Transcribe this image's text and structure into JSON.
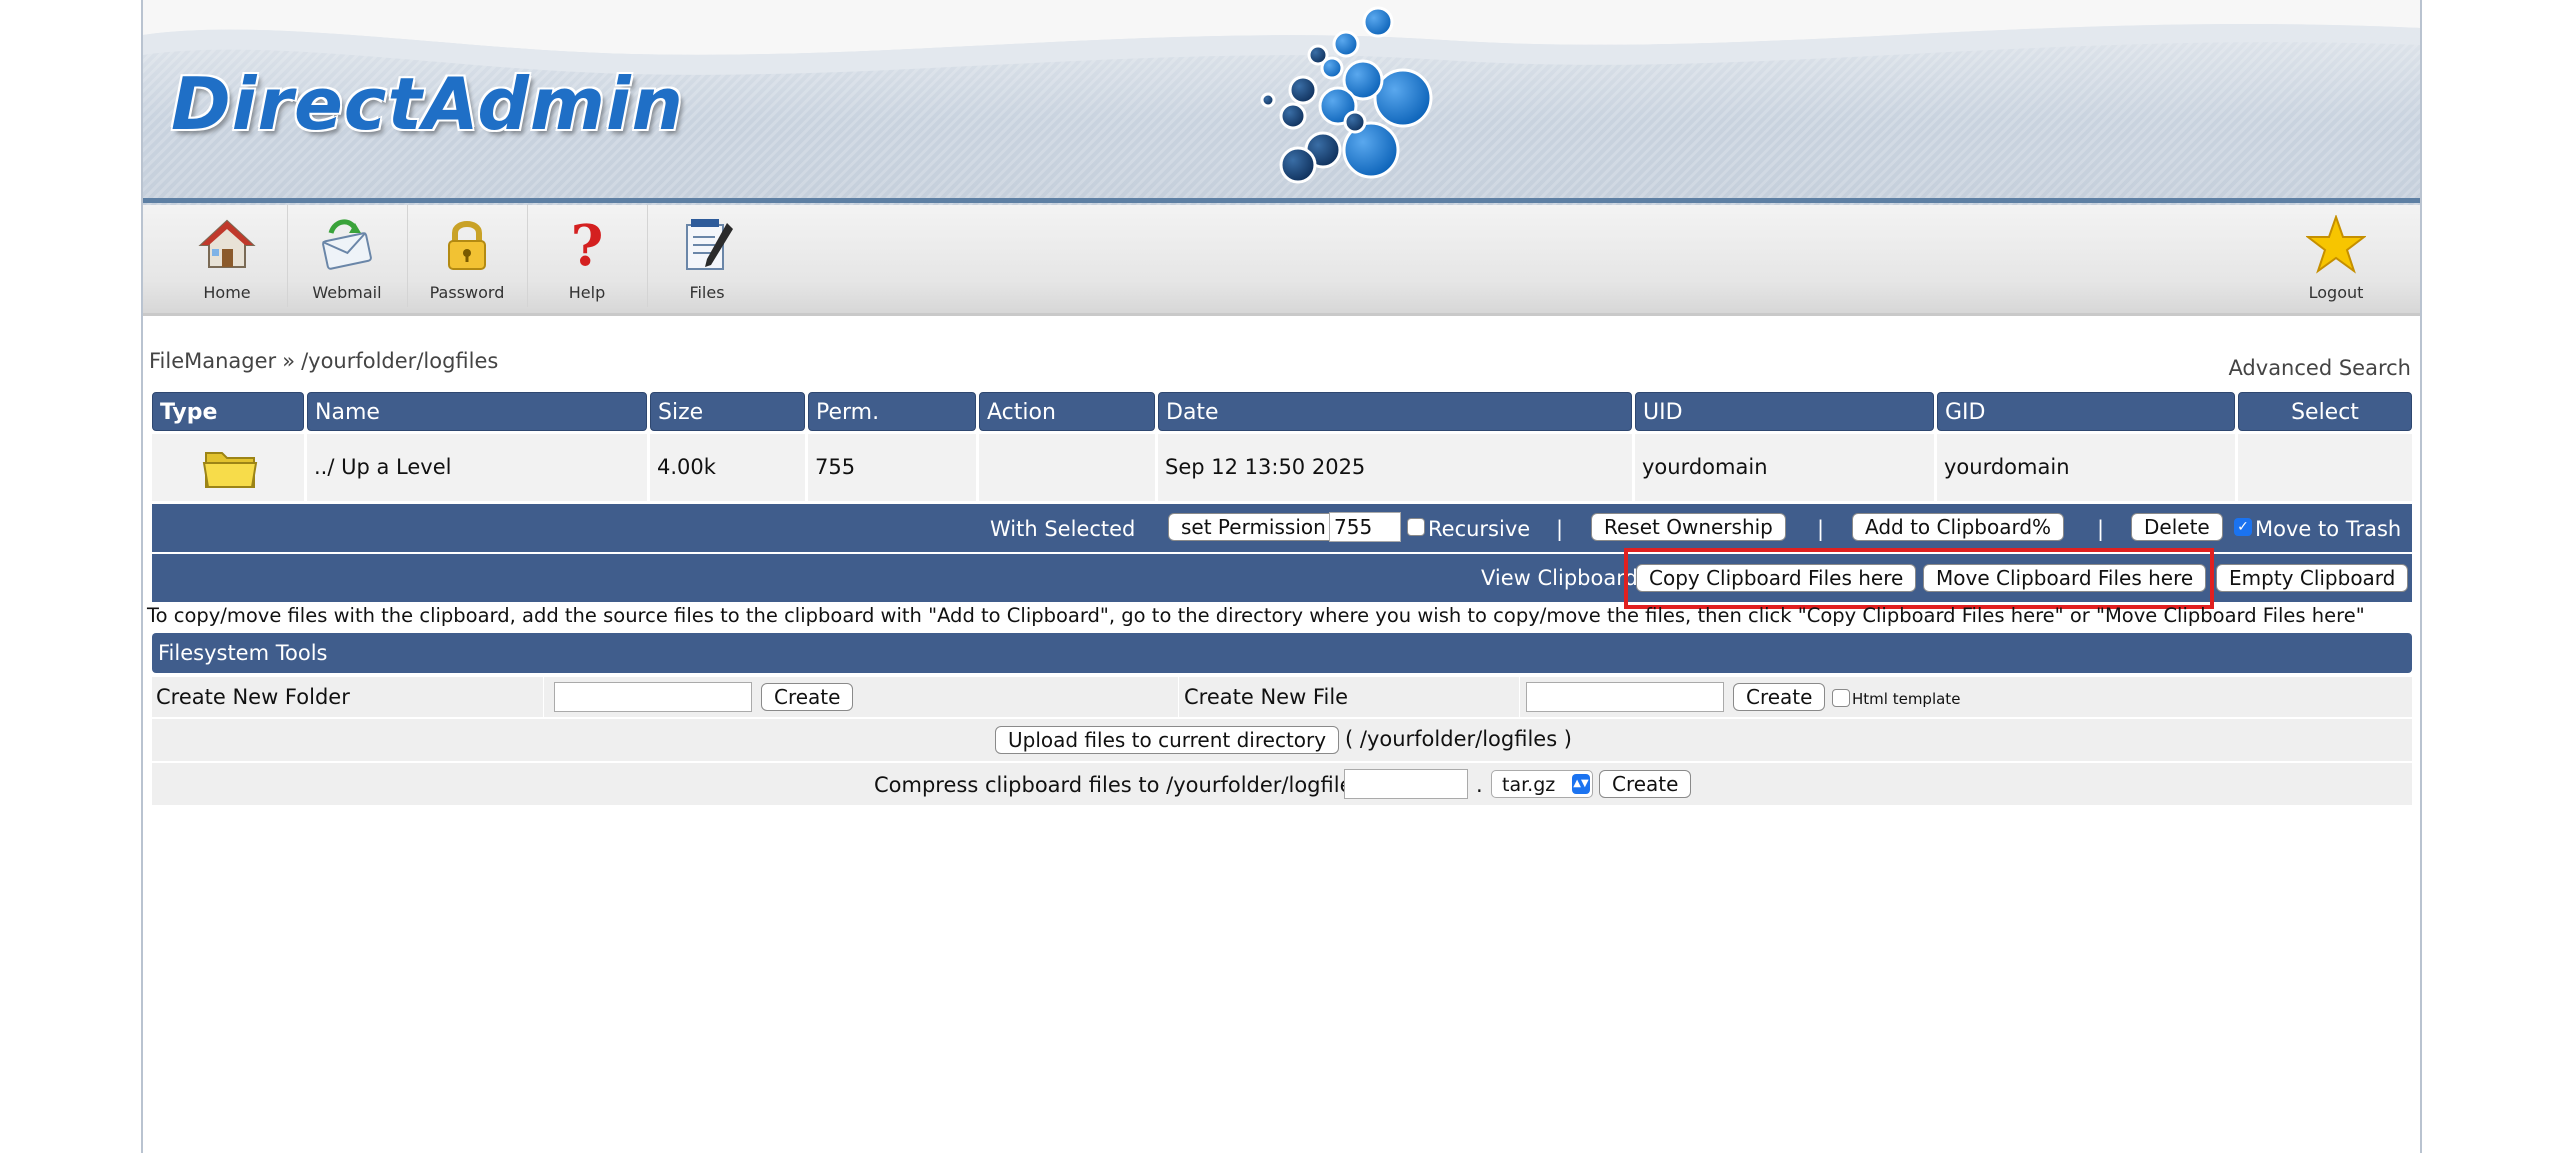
{
  "app": {
    "logo_text": "DirectAdmin"
  },
  "toolbar": {
    "items": [
      {
        "label": "Home",
        "icon": "home-icon"
      },
      {
        "label": "Webmail",
        "icon": "webmail-icon"
      },
      {
        "label": "Password",
        "icon": "lock-icon"
      },
      {
        "label": "Help",
        "icon": "question-icon"
      },
      {
        "label": "Files",
        "icon": "files-icon"
      }
    ],
    "logout_label": "Logout",
    "logout_icon": "star-icon"
  },
  "breadcrumb": {
    "root": "FileManager",
    "separator": "»",
    "path": "/yourfolder/logfiles"
  },
  "advanced_search": "Advanced Search",
  "table": {
    "columns": [
      "Type",
      "Name",
      "Size",
      "Perm.",
      "Action",
      "Date",
      "UID",
      "GID",
      "Select"
    ],
    "rows": [
      {
        "type_icon": "folder-icon",
        "name": "../ Up a Level",
        "size": "4.00k",
        "perm": "755",
        "action": "",
        "date": "Sep 12 13:50 2025",
        "uid": "yourdomain",
        "gid": "yourdomain",
        "select": ""
      }
    ]
  },
  "with_selected": {
    "label": "With Selected",
    "set_permission": "set Permission",
    "permission_value": "755",
    "recursive_label": "Recursive",
    "recursive_checked": false,
    "separator": "|",
    "reset_ownership": "Reset Ownership",
    "add_to_clipboard": "Add to Clipboard%",
    "delete": "Delete",
    "move_to_trash_label": "Move to Trash",
    "move_to_trash_checked": true
  },
  "clipboard": {
    "view_label": "View Clipboard",
    "copy_here": "Copy Clipboard Files here",
    "move_here": "Move Clipboard Files here",
    "empty": "Empty Clipboard"
  },
  "info_text": "To copy/move files with the clipboard, add the source files to the clipboard with \"Add to Clipboard\", go to the directory where you wish to copy/move the files, then click \"Copy Clipboard Files here\" or \"Move Clipboard Files here\"",
  "filesystem_tools": {
    "title": "Filesystem Tools",
    "create_folder_label": "Create New Folder",
    "create_folder_value": "",
    "create_button": "Create",
    "create_file_label": "Create New File",
    "create_file_value": "",
    "html_template_label": "Html template",
    "html_template_checked": false,
    "upload_button": "Upload files to current directory",
    "upload_path": "( /yourfolder/logfiles )",
    "compress_label": "Compress clipboard files to /yourfolder/logfiles/",
    "compress_name_value": "",
    "compress_dot": ".",
    "compress_format": "tar.gz",
    "compress_button": "Create"
  },
  "colors": {
    "header_blue": "#405d8c",
    "logo_blue": "#1f6fc6",
    "highlight_red": "#e02020",
    "checkbox_blue": "#1b73f0"
  }
}
